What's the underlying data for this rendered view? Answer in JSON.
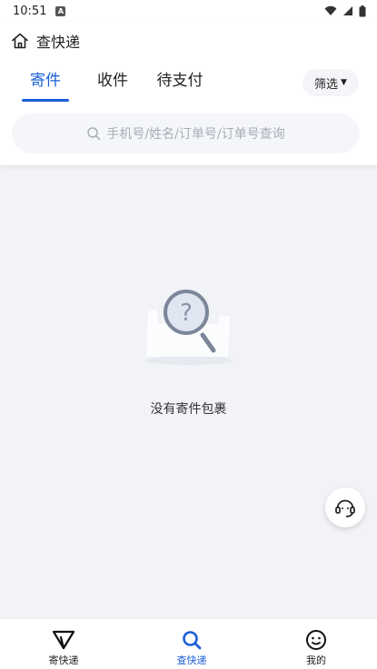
{
  "status_bar": {
    "time": "10:51",
    "notification_badge": "A"
  },
  "header": {
    "title": "查快递"
  },
  "tabs": [
    {
      "label": "寄件",
      "active": true
    },
    {
      "label": "收件",
      "active": false
    },
    {
      "label": "待支付",
      "active": false
    }
  ],
  "filter": {
    "label": "筛选"
  },
  "search": {
    "placeholder": "手机号/姓名/订单号/订单号查询"
  },
  "empty_state": {
    "message": "没有寄件包裹"
  },
  "bottom_nav": [
    {
      "label": "寄快递",
      "icon": "send-icon",
      "active": false
    },
    {
      "label": "查快递",
      "icon": "search-icon",
      "active": true
    },
    {
      "label": "我的",
      "icon": "smiley-icon",
      "active": false
    }
  ],
  "colors": {
    "accent": "#1a5fd8",
    "background": "#f1f3f7"
  }
}
